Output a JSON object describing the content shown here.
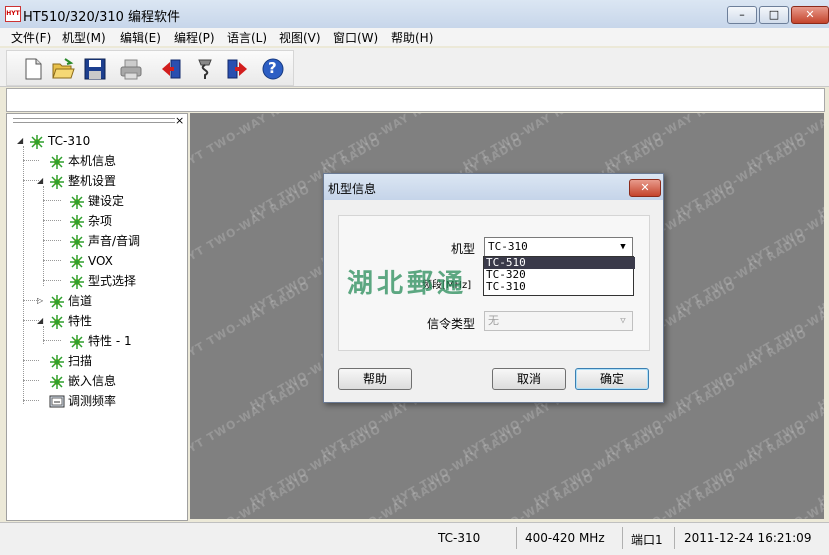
{
  "window": {
    "logo_text": "HYT",
    "title": "HT510/320/310 编程软件",
    "minimize": "–",
    "maximize": "□",
    "close": "✕"
  },
  "menu": [
    "文件(F)",
    "机型(M)",
    "编辑(E)",
    "编程(P)",
    "语言(L)",
    "视图(V)",
    "窗口(W)",
    "帮助(H)"
  ],
  "toolbar": {
    "buttons": [
      {
        "name": "new-file-icon"
      },
      {
        "name": "open-folder-icon"
      },
      {
        "name": "save-icon"
      },
      {
        "name": "print-icon"
      },
      {
        "name": "read-from-radio-icon"
      },
      {
        "name": "connect-cable-icon"
      },
      {
        "name": "write-to-radio-icon"
      },
      {
        "name": "help-icon"
      }
    ],
    "help_glyph": "?"
  },
  "tree": {
    "close_glyph": "×",
    "root": "TC-310",
    "items": {
      "basic_info": "本机信息",
      "whole_setting": "整机设置",
      "key_setting": "键设定",
      "misc": "杂项",
      "sound_tone": "声音/音调",
      "vox": "VOX",
      "model_select": "型式选择",
      "channel": "信道",
      "feature": "特性",
      "feature_1": "特性 - 1",
      "scan": "扫描",
      "embedded_info": "嵌入信息",
      "tune_freq": "调测频率"
    }
  },
  "watermark": "HYT TWO-WAY RADIO",
  "dialog": {
    "title": "机型信息",
    "close": "✕",
    "model_label": "机型",
    "model_value": "TC-310",
    "band_label": "频段[MHz]",
    "signal_label": "信令类型",
    "signal_value": "无",
    "options": [
      "TC-510",
      "TC-320",
      "TC-310"
    ],
    "selected_option_index": 0,
    "help_button": "帮助",
    "cancel_button": "取消",
    "ok_button": "确定",
    "overlay_text": "湖北郵通"
  },
  "status": {
    "model": "TC-310",
    "band": "400-420 MHz",
    "port": "端口1",
    "datetime": "2011-12-24 16:21:09"
  }
}
